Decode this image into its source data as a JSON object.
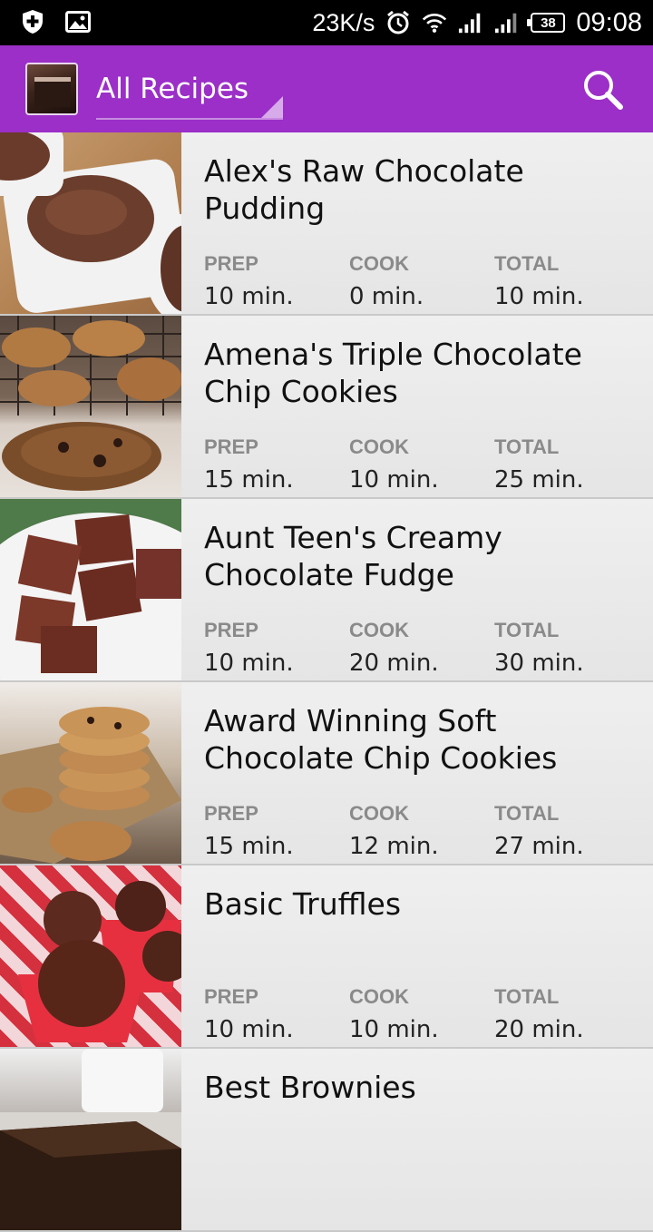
{
  "status_bar": {
    "speed": "23K/s",
    "battery": "38",
    "time": "09:08"
  },
  "app_bar": {
    "spinner_label": "All Recipes",
    "accent_color": "#9b2fc7"
  },
  "stat_labels": {
    "prep": "PREP",
    "cook": "COOK",
    "total": "TOTAL"
  },
  "recipes": [
    {
      "title": "Alex's Raw Chocolate Pudding",
      "prep": "10 min.",
      "cook": "0 min.",
      "total": "10 min.",
      "image": "chocolate-pudding-image"
    },
    {
      "title": "Amena's Triple Chocolate Chip Cookies",
      "prep": "15 min.",
      "cook": "10 min.",
      "total": "25 min.",
      "image": "chocolate-chip-cookies-image"
    },
    {
      "title": "Aunt Teen's Creamy Chocolate Fudge",
      "prep": "10 min.",
      "cook": "20 min.",
      "total": "30 min.",
      "image": "chocolate-fudge-image"
    },
    {
      "title": "Award Winning Soft Chocolate Chip Cookies",
      "prep": "15 min.",
      "cook": "12 min.",
      "total": "27 min.",
      "image": "soft-cookies-image"
    },
    {
      "title": "Basic Truffles",
      "prep": "10 min.",
      "cook": "10 min.",
      "total": "20 min.",
      "image": "truffles-image"
    },
    {
      "title": "Best Brownies",
      "image": "brownies-image"
    }
  ]
}
